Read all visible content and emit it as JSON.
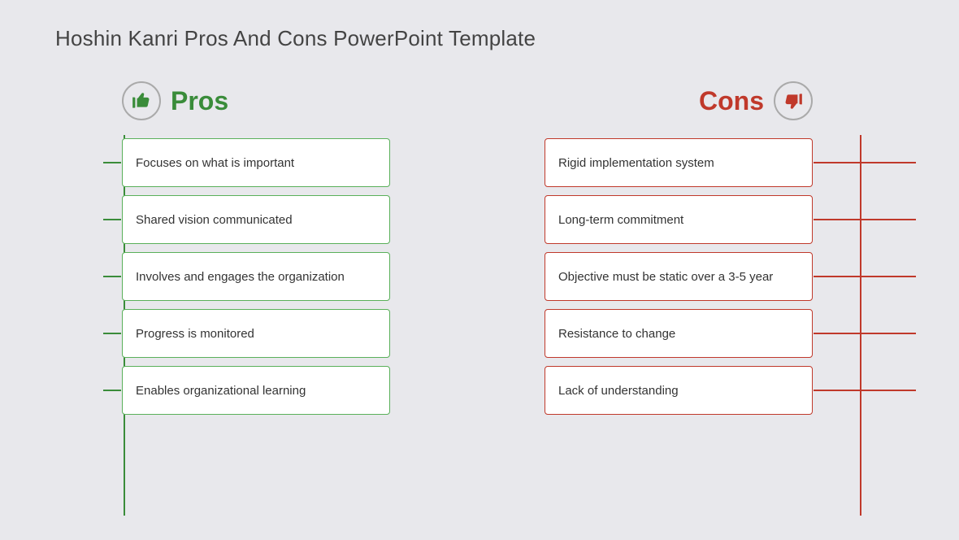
{
  "title": "Hoshin Kanri Pros And Cons PowerPoint Template",
  "pros": {
    "label": "Pros",
    "items": [
      {
        "text": "Focuses on what is important"
      },
      {
        "text": "Shared vision communicated"
      },
      {
        "text": "Involves and engages the organization"
      },
      {
        "text": "Progress is monitored"
      },
      {
        "text": "Enables organizational learning"
      }
    ]
  },
  "cons": {
    "label": "Cons",
    "items": [
      {
        "text": "Rigid implementation system"
      },
      {
        "text": "Long-term commitment"
      },
      {
        "text": "Objective must be static over a 3-5 year"
      },
      {
        "text": "Resistance to change"
      },
      {
        "text": "Lack of understanding"
      }
    ]
  }
}
